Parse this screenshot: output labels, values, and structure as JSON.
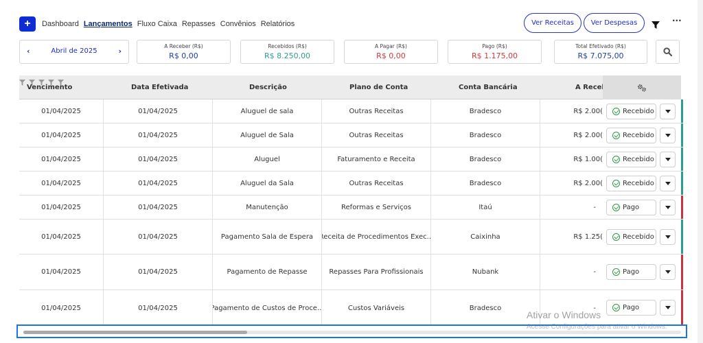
{
  "nav": {
    "add_label": "+",
    "links": [
      "Dashboard",
      "Lançamentos",
      "Fluxo Caixa",
      "Repasses",
      "Convênios",
      "Relatórios"
    ],
    "active_index": 1,
    "ver_receitas": "Ver Receitas",
    "ver_despesas": "Ver Despesas",
    "more": "···"
  },
  "summary": {
    "month": "Abril de 2025",
    "prev": "‹",
    "next": "›",
    "boxes": [
      {
        "label": "A Receber (R$)",
        "value": "R$ 0,00",
        "color": "#1f3fa8"
      },
      {
        "label": "Recebidos (R$)",
        "value": "R$ 8.250,00",
        "color": "#2e9e8f"
      },
      {
        "label": "A Pagar (R$)",
        "value": "R$ 0,00",
        "color": "#d9343a"
      },
      {
        "label": "Pago (R$)",
        "value": "R$ 1.175,00",
        "color": "#d9343a"
      },
      {
        "label": "Total Efetivado (R$)",
        "value": "R$ 7.075,00",
        "color": "#1f3fa8"
      }
    ]
  },
  "table": {
    "headers": [
      "Vencimento",
      "Data Efetivada",
      "Descrição",
      "Plano de Conta",
      "Conta Bancária",
      "A Receb"
    ],
    "rows": [
      {
        "venc": "01/04/2025",
        "efet": "01/04/2025",
        "desc": "Aluguel de sala",
        "plano": "Outras Receitas",
        "conta": "Bradesco",
        "valor": "R$ 2.00(",
        "status": "Recebido",
        "stripe": "#2a9d8f"
      },
      {
        "venc": "01/04/2025",
        "efet": "01/04/2025",
        "desc": "Aluguel de Sala",
        "plano": "Outras Receitas",
        "conta": "Bradesco",
        "valor": "R$ 2.00(",
        "status": "Recebido",
        "stripe": "#2a9d8f"
      },
      {
        "venc": "01/04/2025",
        "efet": "01/04/2025",
        "desc": "Aluguel",
        "plano": "Faturamento e Receita",
        "conta": "Bradesco",
        "valor": "R$ 1.00(",
        "status": "Recebido",
        "stripe": "#2a9d8f"
      },
      {
        "venc": "01/04/2025",
        "efet": "01/04/2025",
        "desc": "Aluguel da Sala",
        "plano": "Outras Receitas",
        "conta": "Bradesco",
        "valor": "R$ 2.00(",
        "status": "Recebido",
        "stripe": "#2a9d8f"
      },
      {
        "venc": "01/04/2025",
        "efet": "01/04/2025",
        "desc": "Manutenção",
        "plano": "Reformas e Serviços",
        "conta": "Itaú",
        "valor": "-",
        "status": "Pago",
        "stripe": "#c7323c"
      },
      {
        "venc": "01/04/2025",
        "efet": "01/04/2025",
        "desc": "Pagamento Sala de Espera",
        "plano": "Receita de Procedimentos Exec...",
        "conta": "Caixinha",
        "valor": "R$ 1.25(",
        "status": "Recebido",
        "stripe": "#2a9d8f"
      },
      {
        "venc": "01/04/2025",
        "efet": "01/04/2025",
        "desc": "Pagamento de Repasse",
        "plano": "Repasses Para Profissionais",
        "conta": "Nubank",
        "valor": "-",
        "status": "Pago",
        "stripe": "#c7323c"
      },
      {
        "venc": "01/04/2025",
        "efet": "01/04/2025",
        "desc": "Pagamento de Custos de Proce...",
        "plano": "Custos Variáveis",
        "conta": "Bradesco",
        "valor": "-",
        "status": "Pago",
        "stripe": "#c7323c"
      }
    ]
  },
  "watermark": {
    "title": "Ativar o Windows",
    "subtitle": "Acesse Configurações para ativar o Windows."
  }
}
